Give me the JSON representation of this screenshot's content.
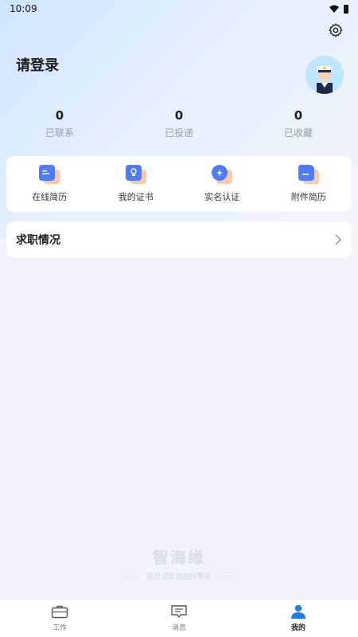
{
  "status_bar": {
    "time": "10:09"
  },
  "header": {
    "login_text": "请登录"
  },
  "stats": [
    {
      "value": "0",
      "label": "已联系"
    },
    {
      "value": "0",
      "label": "已投递"
    },
    {
      "value": "0",
      "label": "已收藏"
    }
  ],
  "tools": [
    {
      "label": "在线简历",
      "icon": "resume-icon"
    },
    {
      "label": "我的证书",
      "icon": "certificate-icon"
    },
    {
      "label": "实名认证",
      "icon": "verify-icon"
    },
    {
      "label": "附件简历",
      "icon": "attachment-icon"
    }
  ],
  "job_status": {
    "title": "求职情况"
  },
  "watermark": {
    "title": "智海缘",
    "subtitle": "船员求职找船好帮手"
  },
  "tabbar": [
    {
      "label": "工作",
      "icon": "briefcase-icon",
      "active": false
    },
    {
      "label": "消息",
      "icon": "message-icon",
      "active": false
    },
    {
      "label": "我的",
      "icon": "user-icon",
      "active": true
    }
  ],
  "colors": {
    "accent": "#4f7cf5",
    "accent_secondary": "#ffc7a6",
    "tab_active": "#1e79f2"
  }
}
